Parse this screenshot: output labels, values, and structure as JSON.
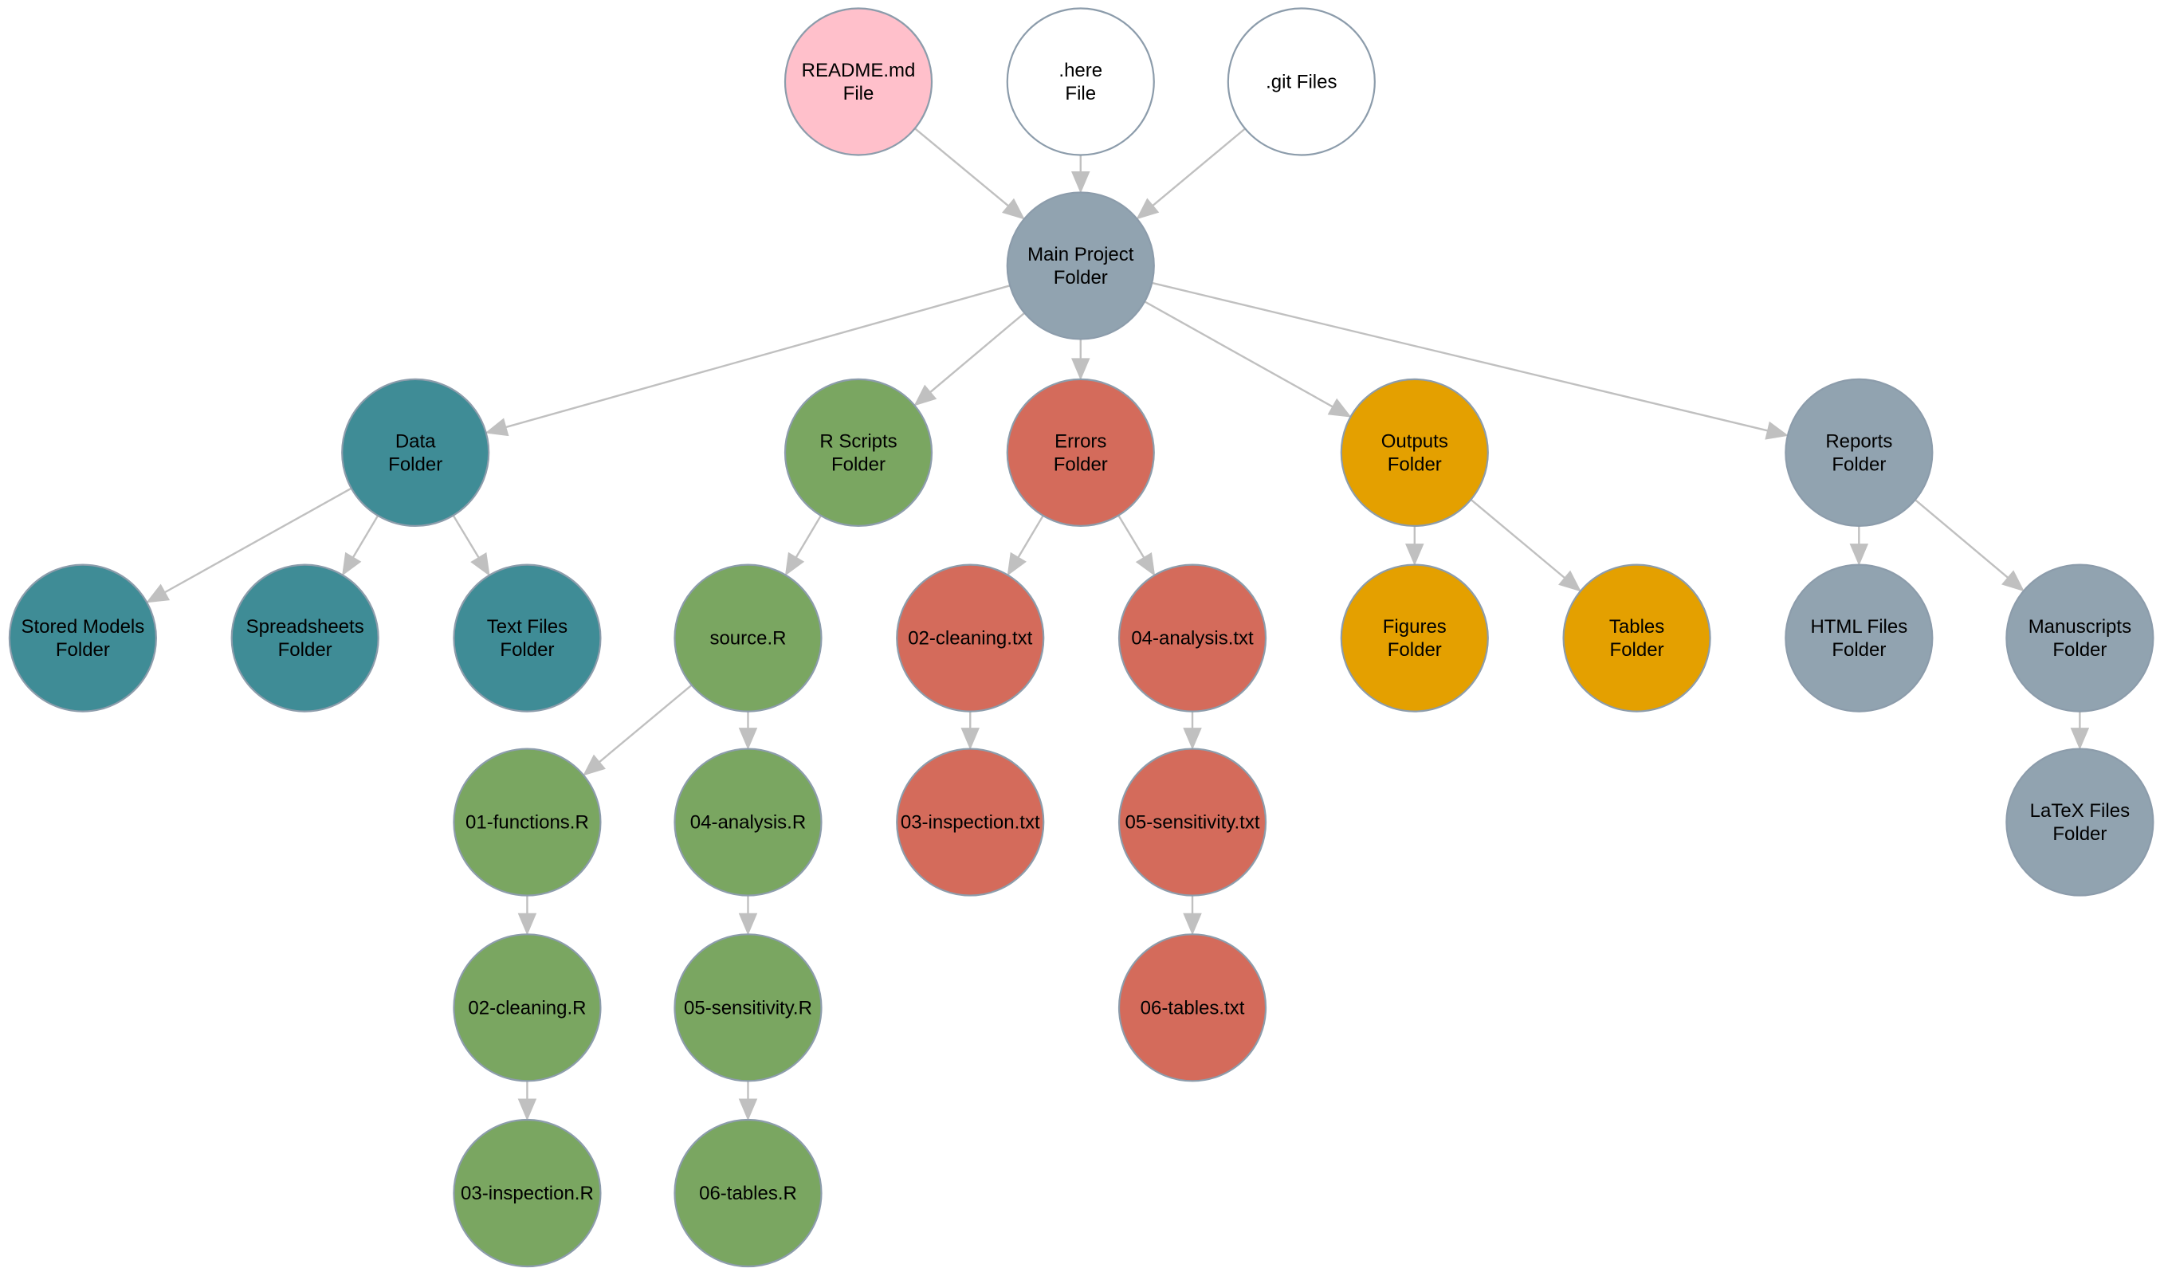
{
  "diagram": {
    "type": "directed-tree",
    "colors": {
      "readme": "#ffc0cb",
      "file": "#ffffff",
      "main": "#91a3b0",
      "data": "#3f8c96",
      "scripts": "#7aa661",
      "errors": "#d46b5b",
      "outputs": "#e4a000",
      "reports": "#91a3b0",
      "edge": "#c0c0c0",
      "node_border": "#8c9cab"
    },
    "nodes": [
      {
        "id": "readme",
        "lines": [
          "README.md",
          "File"
        ],
        "color": "readme"
      },
      {
        "id": "here",
        "lines": [
          ".here",
          "File"
        ],
        "color": "file"
      },
      {
        "id": "git",
        "lines": [
          ".git Files"
        ],
        "color": "file"
      },
      {
        "id": "main",
        "lines": [
          "Main Project",
          "Folder"
        ],
        "color": "main"
      },
      {
        "id": "data",
        "lines": [
          "Data",
          "Folder"
        ],
        "color": "data"
      },
      {
        "id": "rscripts",
        "lines": [
          "R Scripts",
          "Folder"
        ],
        "color": "scripts"
      },
      {
        "id": "errors",
        "lines": [
          "Errors",
          "Folder"
        ],
        "color": "errors"
      },
      {
        "id": "outputs",
        "lines": [
          "Outputs",
          "Folder"
        ],
        "color": "outputs"
      },
      {
        "id": "reports",
        "lines": [
          "Reports",
          "Folder"
        ],
        "color": "reports"
      },
      {
        "id": "stored",
        "lines": [
          "Stored Models",
          "Folder"
        ],
        "color": "data"
      },
      {
        "id": "spreadsheets",
        "lines": [
          "Spreadsheets",
          "Folder"
        ],
        "color": "data"
      },
      {
        "id": "textfiles",
        "lines": [
          "Text Files",
          "Folder"
        ],
        "color": "data"
      },
      {
        "id": "source",
        "lines": [
          "source.R"
        ],
        "color": "scripts"
      },
      {
        "id": "err02",
        "lines": [
          "02-cleaning.txt"
        ],
        "color": "errors"
      },
      {
        "id": "err04",
        "lines": [
          "04-analysis.txt"
        ],
        "color": "errors"
      },
      {
        "id": "figures",
        "lines": [
          "Figures",
          "Folder"
        ],
        "color": "outputs"
      },
      {
        "id": "tables",
        "lines": [
          "Tables",
          "Folder"
        ],
        "color": "outputs"
      },
      {
        "id": "html",
        "lines": [
          "HTML Files",
          "Folder"
        ],
        "color": "reports"
      },
      {
        "id": "manuscripts",
        "lines": [
          "Manuscripts",
          "Folder"
        ],
        "color": "reports"
      },
      {
        "id": "r01",
        "lines": [
          "01-functions.R"
        ],
        "color": "scripts"
      },
      {
        "id": "r04",
        "lines": [
          "04-analysis.R"
        ],
        "color": "scripts"
      },
      {
        "id": "err03",
        "lines": [
          "03-inspection.txt"
        ],
        "color": "errors"
      },
      {
        "id": "err05",
        "lines": [
          "05-sensitivity.txt"
        ],
        "color": "errors"
      },
      {
        "id": "latex",
        "lines": [
          "LaTeX Files",
          "Folder"
        ],
        "color": "reports"
      },
      {
        "id": "r02",
        "lines": [
          "02-cleaning.R"
        ],
        "color": "scripts"
      },
      {
        "id": "r05",
        "lines": [
          "05-sensitivity.R"
        ],
        "color": "scripts"
      },
      {
        "id": "err06",
        "lines": [
          "06-tables.txt"
        ],
        "color": "errors"
      },
      {
        "id": "r03",
        "lines": [
          "03-inspection.R"
        ],
        "color": "scripts"
      },
      {
        "id": "r06",
        "lines": [
          "06-tables.R"
        ],
        "color": "scripts"
      }
    ],
    "edges": [
      [
        "readme",
        "main"
      ],
      [
        "here",
        "main"
      ],
      [
        "git",
        "main"
      ],
      [
        "main",
        "data"
      ],
      [
        "main",
        "rscripts"
      ],
      [
        "main",
        "errors"
      ],
      [
        "main",
        "outputs"
      ],
      [
        "main",
        "reports"
      ],
      [
        "data",
        "stored"
      ],
      [
        "data",
        "spreadsheets"
      ],
      [
        "data",
        "textfiles"
      ],
      [
        "rscripts",
        "source"
      ],
      [
        "errors",
        "err02"
      ],
      [
        "errors",
        "err04"
      ],
      [
        "outputs",
        "figures"
      ],
      [
        "outputs",
        "tables"
      ],
      [
        "reports",
        "html"
      ],
      [
        "reports",
        "manuscripts"
      ],
      [
        "source",
        "r01"
      ],
      [
        "source",
        "r04"
      ],
      [
        "err02",
        "err03"
      ],
      [
        "err04",
        "err05"
      ],
      [
        "manuscripts",
        "latex"
      ],
      [
        "r01",
        "r02"
      ],
      [
        "r04",
        "r05"
      ],
      [
        "err05",
        "err06"
      ],
      [
        "r02",
        "r03"
      ],
      [
        "r05",
        "r06"
      ]
    ]
  }
}
